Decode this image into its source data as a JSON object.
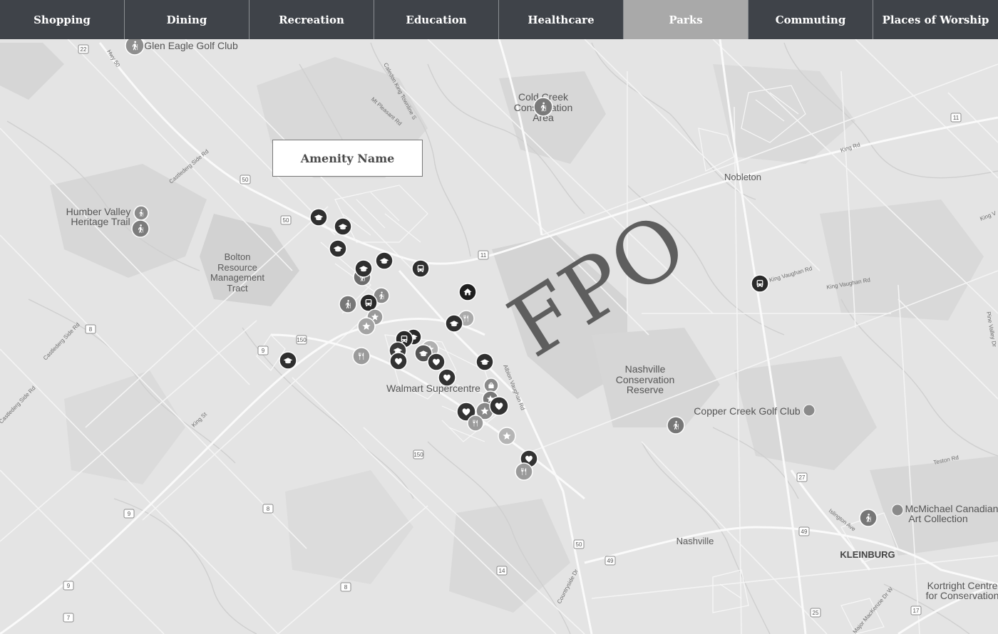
{
  "nav": {
    "tabs": [
      {
        "label": "Shopping",
        "active": false
      },
      {
        "label": "Dining",
        "active": false
      },
      {
        "label": "Recreation",
        "active": false
      },
      {
        "label": "Education",
        "active": false
      },
      {
        "label": "Healthcare",
        "active": false
      },
      {
        "label": "Parks",
        "active": true
      },
      {
        "label": "Commuting",
        "active": false
      },
      {
        "label": "Places of Worship",
        "active": false
      }
    ]
  },
  "tooltip": {
    "label": "Amenity Name"
  },
  "watermark": {
    "text": "FPO"
  },
  "map": {
    "places": {
      "glen_eagle": "Glen Eagle Golf Club",
      "cold_creek_1": "Cold Creek",
      "cold_creek_2": "Conservation",
      "cold_creek_3": "Area",
      "nobleton": "Nobleton",
      "humber_1": "Humber Valley",
      "humber_2": "Heritage Trail",
      "bolton_1": "Bolton",
      "bolton_2": "Resource",
      "bolton_3": "Management",
      "bolton_4": "Tract",
      "walmart": "Walmart Supercentre",
      "nashville_cons_1": "Nashville",
      "nashville_cons_2": "Conservation",
      "nashville_cons_3": "Reserve",
      "copper_creek": "Copper Creek Golf Club",
      "nashville": "Nashville",
      "kleinburg": "KLEINBURG",
      "mcmichael_1": "McMichael Canadian",
      "mcmichael_2": "Art Collection",
      "kortright_1": "Kortright Centre",
      "kortright_2": "for Conservation"
    },
    "roads": {
      "hwy50": "Hwy 50",
      "caledon_king": "Caledon King Townline S",
      "mt_pleasant": "Mt Pleasant Rd",
      "castlederg_side": "Castlederg Side Rd",
      "castlederg_side2": "Castlederg Side Rd",
      "castlederg_side3": "Castlederg Side Rd",
      "king_rd": "King Rd",
      "king_vaughan": "King Vaughan Rd",
      "king_vaughan2": "King Vaughan Rd",
      "king_st": "King St",
      "albion_vaughan": "Albion Vaughan Rd",
      "countryside": "Countryside Dr",
      "teston": "Teston Rd",
      "islington": "Islington Ave",
      "pine_valley": "Pine Valley Dr",
      "mackenzie": "Major MacKenzie Dr W",
      "king_v_edge": "King V"
    },
    "shields": [
      "22",
      "50",
      "50",
      "11",
      "11",
      "8",
      "9",
      "150",
      "150",
      "9",
      "8",
      "50",
      "49",
      "49",
      "27",
      "14",
      "8",
      "9",
      "7",
      "25",
      "17"
    ]
  }
}
